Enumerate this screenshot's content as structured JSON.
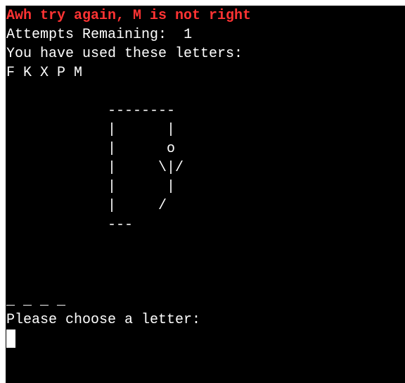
{
  "terminal": {
    "background": "#000000",
    "foreground": "#ffffff"
  },
  "game": {
    "status_message": "Awh try again, M is not right",
    "status_color": "#ff3333",
    "attempts_label": "Attempts Remaining:",
    "attempts_remaining": "1",
    "used_letters_label": "You have used these letters:",
    "used_letters": "F K X P M",
    "hangman_art": "            --------\n            |      |\n            |      o\n            |     \\|/\n            |      |\n            |     /\n            ---",
    "word_progress": "_ _ _ _",
    "prompt": "Please choose a letter:",
    "input_value": ""
  }
}
